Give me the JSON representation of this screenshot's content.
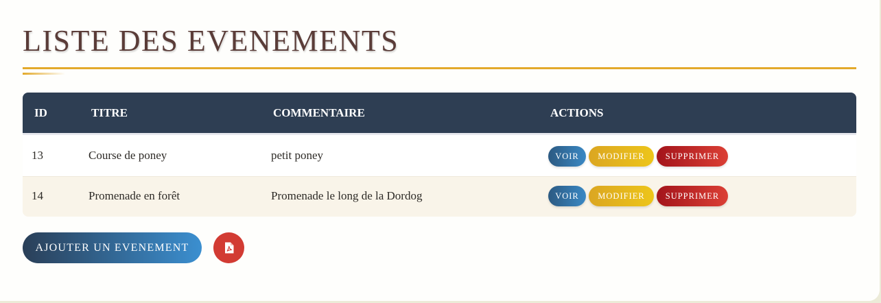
{
  "page": {
    "title": "LISTE DES EVENEMENTS"
  },
  "table": {
    "headers": [
      "ID",
      "TITRE",
      "COMMENTAIRE",
      "ACTIONS"
    ],
    "rows": [
      {
        "id": "13",
        "titre": "Course de poney",
        "commentaire": "petit poney"
      },
      {
        "id": "14",
        "titre": "Promenade en forêt",
        "commentaire": "Promenade le long de la Dordog"
      }
    ],
    "actions": {
      "view_label": "VOIR",
      "edit_label": "MODIFIER",
      "delete_label": "SUPPRIMER"
    }
  },
  "footer": {
    "add_label": "AJOUTER UN EVENEMENT",
    "pdf_icon": "file-pdf-icon"
  },
  "colors": {
    "header_bg": "#2e3e53",
    "accent_gold": "#e3a92a",
    "view": "#3a88c4",
    "edit": "#edc51a",
    "delete": "#db3f35",
    "pdf": "#d23b33"
  }
}
